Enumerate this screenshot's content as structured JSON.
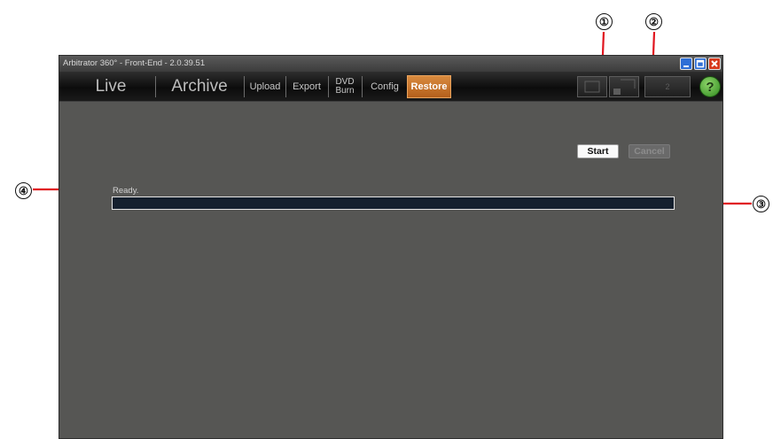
{
  "window": {
    "title": "Arbitrator 360° - Front-End - 2.0.39.51",
    "controls": [
      "minimize-icon",
      "maximize-icon",
      "close-icon"
    ]
  },
  "menu": {
    "live": "Live",
    "archive": "Archive",
    "upload": "Upload",
    "export": "Export",
    "dvd_burn": {
      "line1": "DVD",
      "line2": "Burn"
    },
    "config": "Config",
    "restore": "Restore",
    "active_tab": "Restore",
    "tool_button_label": "2",
    "help": "?"
  },
  "actions": {
    "start": "Start",
    "cancel": "Cancel",
    "cancel_enabled": false
  },
  "status": {
    "text": "Ready.",
    "progress": 0
  },
  "callouts": [
    "①",
    "②",
    "③",
    "④"
  ],
  "colors": {
    "accent_active_tab": "#c8752b",
    "callout_line": "#e0141e",
    "window_background": "#565654",
    "progress_track": "#15202e"
  }
}
